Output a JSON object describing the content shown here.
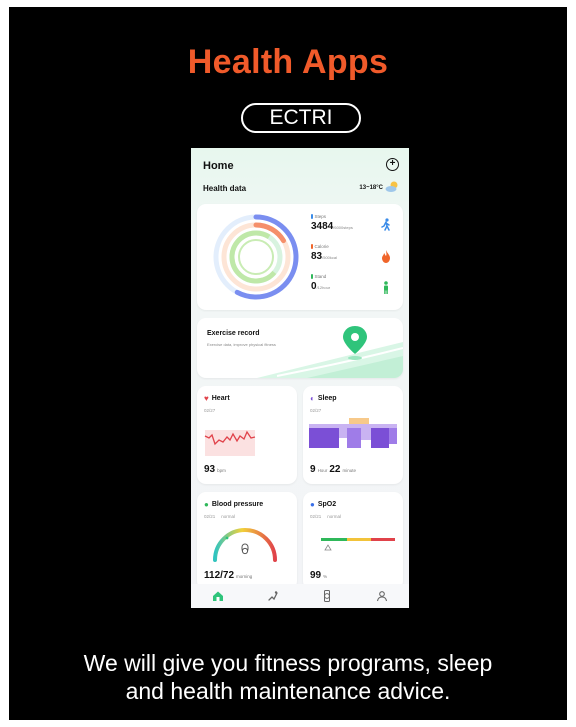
{
  "banner": {
    "title": "Health Apps",
    "brand": "ECTRI",
    "caption_line1": "We will give you fitness programs, sleep",
    "caption_line2": "and health maintenance advice."
  },
  "app": {
    "page_title": "Home",
    "section_title": "Health data",
    "weather": "13~18°C",
    "metrics": [
      {
        "label": "Steps",
        "value": "3484",
        "goal": "/6000steps",
        "color": "#3a8be8",
        "icon": "walking-person-icon"
      },
      {
        "label": "Calorie",
        "value": "83",
        "goal": "/500kcal",
        "color": "#f0652a",
        "icon": "flame-icon"
      },
      {
        "label": "Stand",
        "value": "0",
        "goal": "/12hour",
        "color": "#2fb85a",
        "icon": "standing-person-icon"
      }
    ],
    "exercise": {
      "title": "Exercise record",
      "subtitle": "Exercise data, improve physical fitness"
    },
    "heart": {
      "title": "Heart",
      "date": "02/27",
      "value": "93",
      "unit": "bpm"
    },
    "sleep": {
      "title": "Sleep",
      "date": "02/27",
      "hours": "9",
      "hours_unit": "Hour",
      "minutes": "22",
      "minutes_unit": "minute"
    },
    "blood_pressure": {
      "title": "Blood pressure",
      "date": "02/21",
      "status": "normal",
      "value": "112/72",
      "period": "morning"
    },
    "spo2": {
      "title": "SpO2",
      "date": "02/21",
      "status": "normal",
      "value": "99",
      "unit": "%"
    },
    "tabs": [
      "home-icon",
      "exercise-icon",
      "watch-icon",
      "profile-icon"
    ]
  },
  "colors": {
    "title_orange": "#f05a2a",
    "accent_green": "#2fc47b",
    "heart_red": "#e0424a",
    "sleep_purple": "#7b4fd6"
  }
}
